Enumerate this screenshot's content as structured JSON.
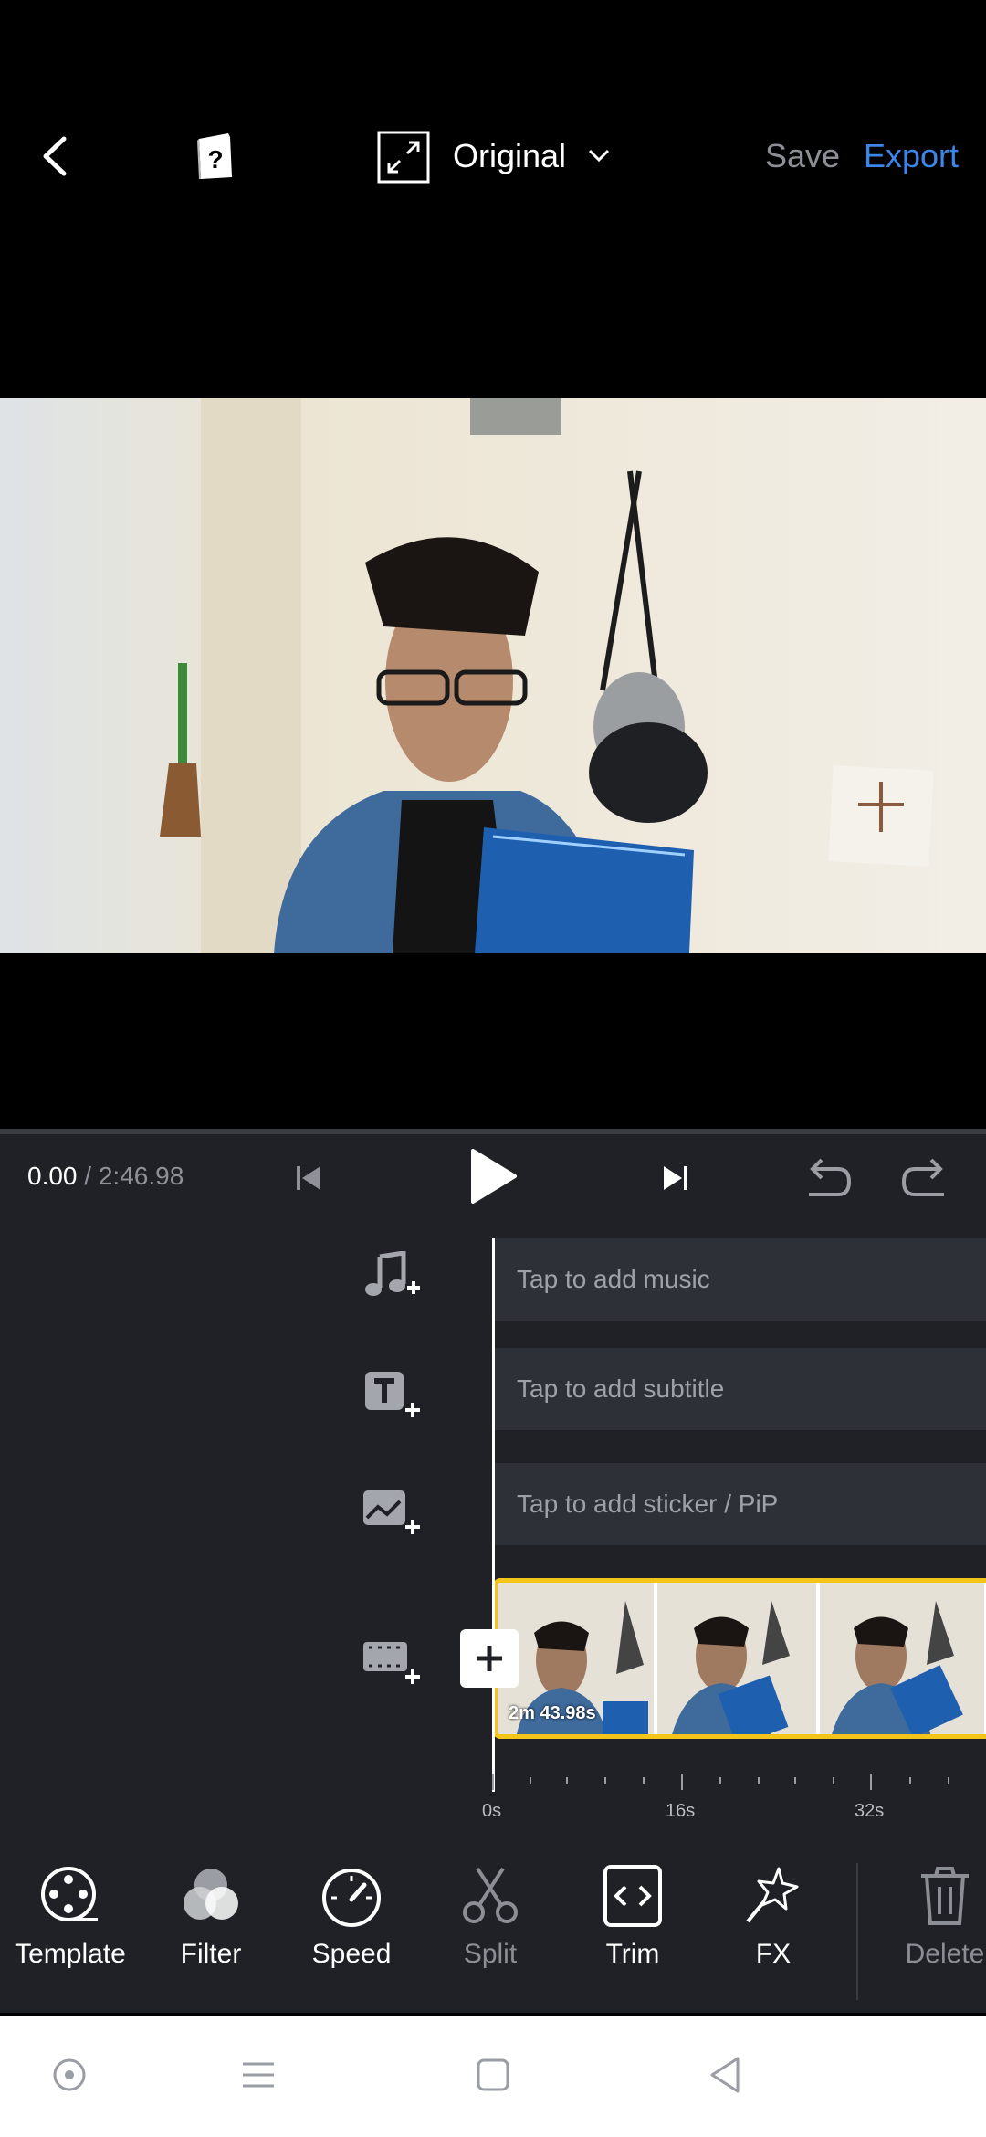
{
  "header": {
    "aspect_label": "Original",
    "save_label": "Save",
    "export_label": "Export"
  },
  "playback": {
    "current_time": "0.00",
    "total_time": "/ 2:46.98"
  },
  "tracks": {
    "music_placeholder": "Tap to add music",
    "subtitle_placeholder": "Tap to add subtitle",
    "sticker_placeholder": "Tap to add sticker / PiP"
  },
  "clip": {
    "duration_label": "2m 43.98s"
  },
  "ruler": {
    "labels": [
      "0s",
      "16s",
      "32s"
    ]
  },
  "toolbar": {
    "template": "Template",
    "filter": "Filter",
    "speed": "Speed",
    "split": "Split",
    "trim": "Trim",
    "fx": "FX",
    "delete": "Delete"
  },
  "colors": {
    "accent_blue": "#3b86e8",
    "clip_border": "#f3c51b",
    "panel_bg": "#1f2126"
  }
}
